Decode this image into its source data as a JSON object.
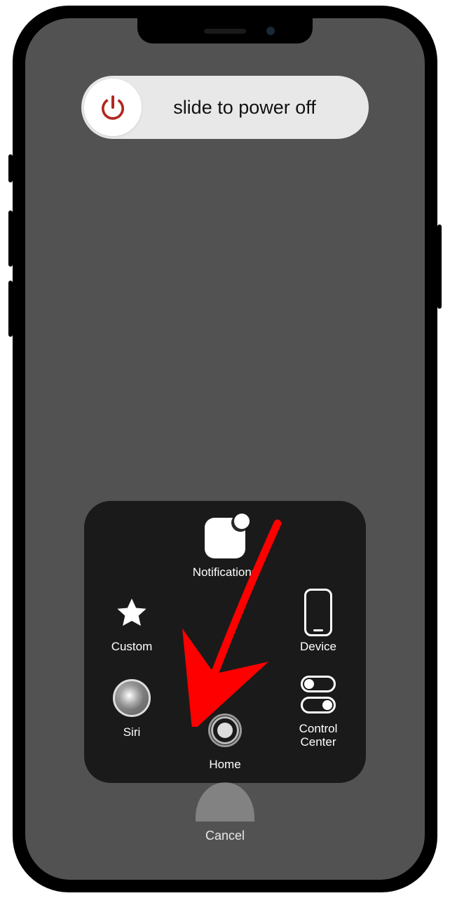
{
  "power_slider": {
    "label": "slide to power off"
  },
  "assistivetouch": {
    "notifications": {
      "label": "Notifications"
    },
    "custom": {
      "label": "Custom"
    },
    "device": {
      "label": "Device"
    },
    "siri": {
      "label": "Siri"
    },
    "control_center": {
      "label": "Control\nCenter"
    },
    "home": {
      "label": "Home"
    }
  },
  "cancel": {
    "label": "Cancel"
  }
}
